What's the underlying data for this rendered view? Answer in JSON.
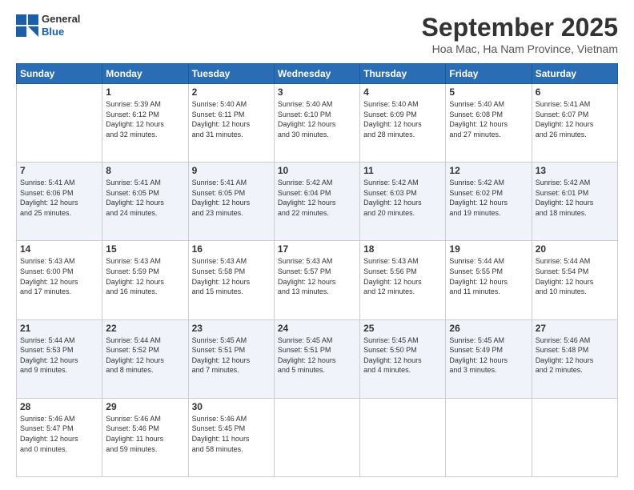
{
  "logo": {
    "line1": "General",
    "line2": "Blue"
  },
  "title": "September 2025",
  "location": "Hoa Mac, Ha Nam Province, Vietnam",
  "weekdays": [
    "Sunday",
    "Monday",
    "Tuesday",
    "Wednesday",
    "Thursday",
    "Friday",
    "Saturday"
  ],
  "weeks": [
    [
      {
        "day": "",
        "info": ""
      },
      {
        "day": "1",
        "info": "Sunrise: 5:39 AM\nSunset: 6:12 PM\nDaylight: 12 hours\nand 32 minutes."
      },
      {
        "day": "2",
        "info": "Sunrise: 5:40 AM\nSunset: 6:11 PM\nDaylight: 12 hours\nand 31 minutes."
      },
      {
        "day": "3",
        "info": "Sunrise: 5:40 AM\nSunset: 6:10 PM\nDaylight: 12 hours\nand 30 minutes."
      },
      {
        "day": "4",
        "info": "Sunrise: 5:40 AM\nSunset: 6:09 PM\nDaylight: 12 hours\nand 28 minutes."
      },
      {
        "day": "5",
        "info": "Sunrise: 5:40 AM\nSunset: 6:08 PM\nDaylight: 12 hours\nand 27 minutes."
      },
      {
        "day": "6",
        "info": "Sunrise: 5:41 AM\nSunset: 6:07 PM\nDaylight: 12 hours\nand 26 minutes."
      }
    ],
    [
      {
        "day": "7",
        "info": "Sunrise: 5:41 AM\nSunset: 6:06 PM\nDaylight: 12 hours\nand 25 minutes."
      },
      {
        "day": "8",
        "info": "Sunrise: 5:41 AM\nSunset: 6:05 PM\nDaylight: 12 hours\nand 24 minutes."
      },
      {
        "day": "9",
        "info": "Sunrise: 5:41 AM\nSunset: 6:05 PM\nDaylight: 12 hours\nand 23 minutes."
      },
      {
        "day": "10",
        "info": "Sunrise: 5:42 AM\nSunset: 6:04 PM\nDaylight: 12 hours\nand 22 minutes."
      },
      {
        "day": "11",
        "info": "Sunrise: 5:42 AM\nSunset: 6:03 PM\nDaylight: 12 hours\nand 20 minutes."
      },
      {
        "day": "12",
        "info": "Sunrise: 5:42 AM\nSunset: 6:02 PM\nDaylight: 12 hours\nand 19 minutes."
      },
      {
        "day": "13",
        "info": "Sunrise: 5:42 AM\nSunset: 6:01 PM\nDaylight: 12 hours\nand 18 minutes."
      }
    ],
    [
      {
        "day": "14",
        "info": "Sunrise: 5:43 AM\nSunset: 6:00 PM\nDaylight: 12 hours\nand 17 minutes."
      },
      {
        "day": "15",
        "info": "Sunrise: 5:43 AM\nSunset: 5:59 PM\nDaylight: 12 hours\nand 16 minutes."
      },
      {
        "day": "16",
        "info": "Sunrise: 5:43 AM\nSunset: 5:58 PM\nDaylight: 12 hours\nand 15 minutes."
      },
      {
        "day": "17",
        "info": "Sunrise: 5:43 AM\nSunset: 5:57 PM\nDaylight: 12 hours\nand 13 minutes."
      },
      {
        "day": "18",
        "info": "Sunrise: 5:43 AM\nSunset: 5:56 PM\nDaylight: 12 hours\nand 12 minutes."
      },
      {
        "day": "19",
        "info": "Sunrise: 5:44 AM\nSunset: 5:55 PM\nDaylight: 12 hours\nand 11 minutes."
      },
      {
        "day": "20",
        "info": "Sunrise: 5:44 AM\nSunset: 5:54 PM\nDaylight: 12 hours\nand 10 minutes."
      }
    ],
    [
      {
        "day": "21",
        "info": "Sunrise: 5:44 AM\nSunset: 5:53 PM\nDaylight: 12 hours\nand 9 minutes."
      },
      {
        "day": "22",
        "info": "Sunrise: 5:44 AM\nSunset: 5:52 PM\nDaylight: 12 hours\nand 8 minutes."
      },
      {
        "day": "23",
        "info": "Sunrise: 5:45 AM\nSunset: 5:51 PM\nDaylight: 12 hours\nand 7 minutes."
      },
      {
        "day": "24",
        "info": "Sunrise: 5:45 AM\nSunset: 5:51 PM\nDaylight: 12 hours\nand 5 minutes."
      },
      {
        "day": "25",
        "info": "Sunrise: 5:45 AM\nSunset: 5:50 PM\nDaylight: 12 hours\nand 4 minutes."
      },
      {
        "day": "26",
        "info": "Sunrise: 5:45 AM\nSunset: 5:49 PM\nDaylight: 12 hours\nand 3 minutes."
      },
      {
        "day": "27",
        "info": "Sunrise: 5:46 AM\nSunset: 5:48 PM\nDaylight: 12 hours\nand 2 minutes."
      }
    ],
    [
      {
        "day": "28",
        "info": "Sunrise: 5:46 AM\nSunset: 5:47 PM\nDaylight: 12 hours\nand 0 minutes."
      },
      {
        "day": "29",
        "info": "Sunrise: 5:46 AM\nSunset: 5:46 PM\nDaylight: 11 hours\nand 59 minutes."
      },
      {
        "day": "30",
        "info": "Sunrise: 5:46 AM\nSunset: 5:45 PM\nDaylight: 11 hours\nand 58 minutes."
      },
      {
        "day": "",
        "info": ""
      },
      {
        "day": "",
        "info": ""
      },
      {
        "day": "",
        "info": ""
      },
      {
        "day": "",
        "info": ""
      }
    ]
  ]
}
